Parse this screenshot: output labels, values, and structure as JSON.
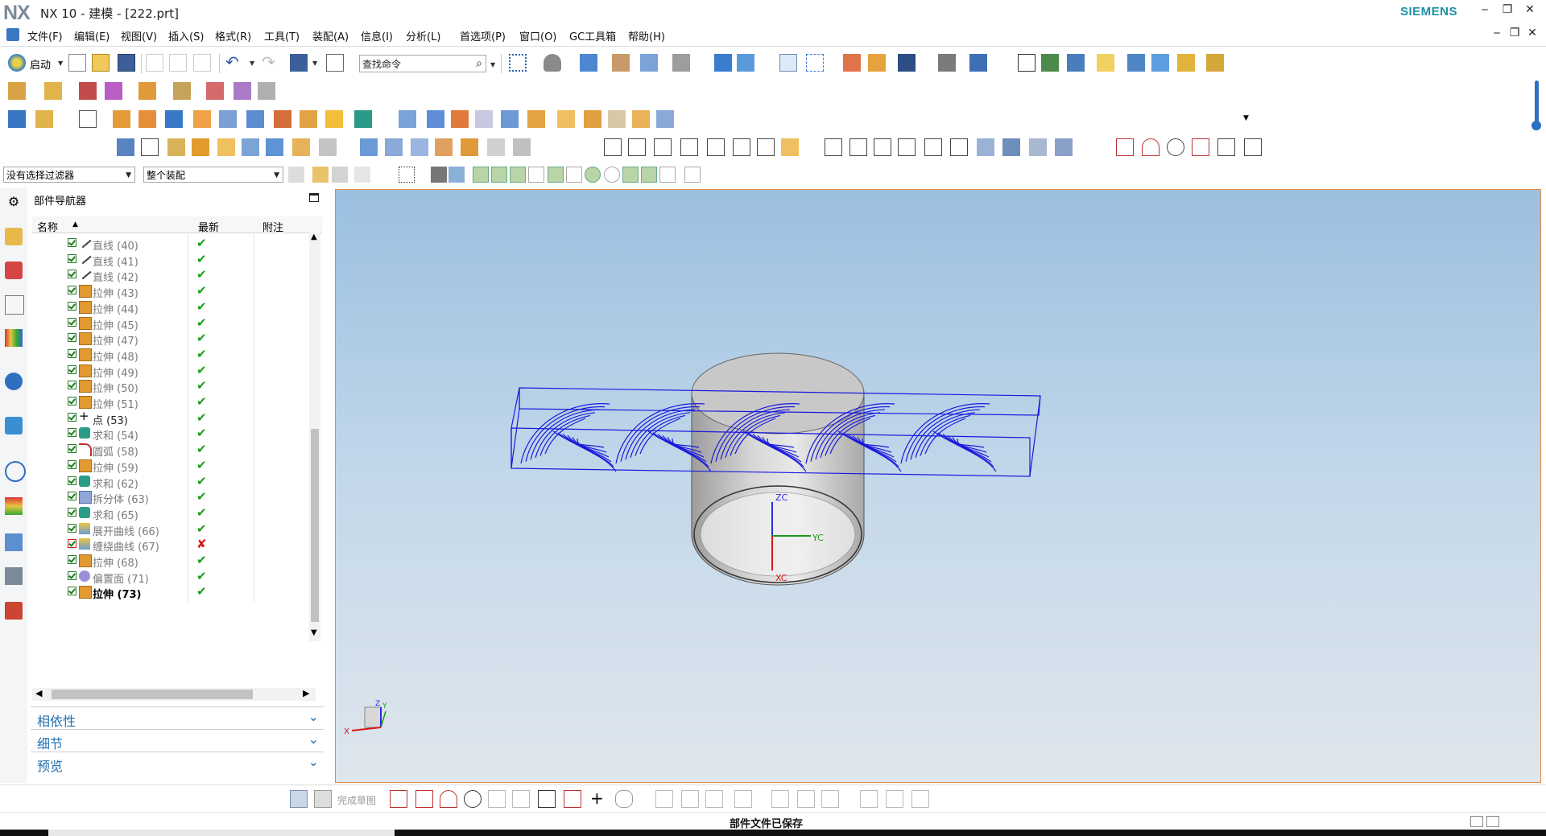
{
  "window": {
    "logo": "NX",
    "title": "NX 10 - 建模 - [222.prt]",
    "brand": "SIEMENS"
  },
  "menu": [
    "文件(F)",
    "编辑(E)",
    "视图(V)",
    "插入(S)",
    "格式(R)",
    "工具(T)",
    "装配(A)",
    "信息(I)",
    "分析(L)",
    "首选项(P)",
    "窗口(O)",
    "GC工具箱",
    "帮助(H)"
  ],
  "toolbar": {
    "start_label": "启动",
    "search_placeholder": "查找命令"
  },
  "filters": {
    "selection_filter": "没有选择过滤器",
    "scope": "整个装配"
  },
  "navigator": {
    "title": "部件导航器",
    "columns": [
      "名称",
      "最新",
      "附注"
    ],
    "rows": [
      {
        "label": "直线 (40)",
        "icon": "line-icon",
        "status": "✔",
        "ok": true
      },
      {
        "label": "直线 (41)",
        "icon": "line-icon",
        "status": "✔",
        "ok": true
      },
      {
        "label": "直线 (42)",
        "icon": "line-icon",
        "status": "✔",
        "ok": true
      },
      {
        "label": "拉伸 (43)",
        "icon": "extrude-icon",
        "status": "✔",
        "ok": true
      },
      {
        "label": "拉伸 (44)",
        "icon": "extrude-icon",
        "status": "✔",
        "ok": true
      },
      {
        "label": "拉伸 (45)",
        "icon": "extrude-icon",
        "status": "✔",
        "ok": true
      },
      {
        "label": "拉伸 (47)",
        "icon": "extrude-icon",
        "status": "✔",
        "ok": true
      },
      {
        "label": "拉伸 (48)",
        "icon": "extrude-icon",
        "status": "✔",
        "ok": true
      },
      {
        "label": "拉伸 (49)",
        "icon": "extrude-icon",
        "status": "✔",
        "ok": true
      },
      {
        "label": "拉伸 (50)",
        "icon": "extrude-icon",
        "status": "✔",
        "ok": true
      },
      {
        "label": "拉伸 (51)",
        "icon": "extrude-icon",
        "status": "✔",
        "ok": true
      },
      {
        "label": "点 (53)",
        "icon": "point-icon",
        "status": "✔",
        "ok": true,
        "strong": false,
        "dark": true
      },
      {
        "label": "求和 (54)",
        "icon": "unite-icon",
        "status": "✔",
        "ok": true
      },
      {
        "label": "圆弧 (58)",
        "icon": "arc-icon",
        "status": "✔",
        "ok": true
      },
      {
        "label": "拉伸 (59)",
        "icon": "extrude-icon",
        "status": "✔",
        "ok": true
      },
      {
        "label": "求和 (62)",
        "icon": "unite-icon",
        "status": "✔",
        "ok": true
      },
      {
        "label": "拆分体 (63)",
        "icon": "split-body-icon",
        "status": "✔",
        "ok": true
      },
      {
        "label": "求和 (65)",
        "icon": "unite-icon",
        "status": "✔",
        "ok": true
      },
      {
        "label": "展开曲线 (66)",
        "icon": "unwrap-curve-icon",
        "status": "✔",
        "ok": true
      },
      {
        "label": "缠绕曲线 (67)",
        "icon": "wrap-curve-icon",
        "status": "✘",
        "ok": false
      },
      {
        "label": "拉伸 (68)",
        "icon": "extrude-icon",
        "status": "✔",
        "ok": true
      },
      {
        "label": "偏置面 (71)",
        "icon": "offset-face-icon",
        "status": "✔",
        "ok": true
      },
      {
        "label": "拉伸 (73)",
        "icon": "extrude-icon",
        "status": "✔",
        "ok": true,
        "strong": true
      }
    ],
    "sections": [
      "相依性",
      "细节",
      "预览"
    ]
  },
  "viewport": {
    "axes": {
      "zc": "ZC",
      "yc": "YC",
      "xc": "XC"
    },
    "triad": {
      "x": "X",
      "y": "Y",
      "z": "Z"
    }
  },
  "sketchbar": {
    "finish_label": "完成草图"
  },
  "status": {
    "message": "部件文件已保存"
  },
  "colors": {
    "accent": "#1f6fb0",
    "wire": "#1a1adc",
    "ok": "#17a018",
    "error": "#d41414"
  }
}
